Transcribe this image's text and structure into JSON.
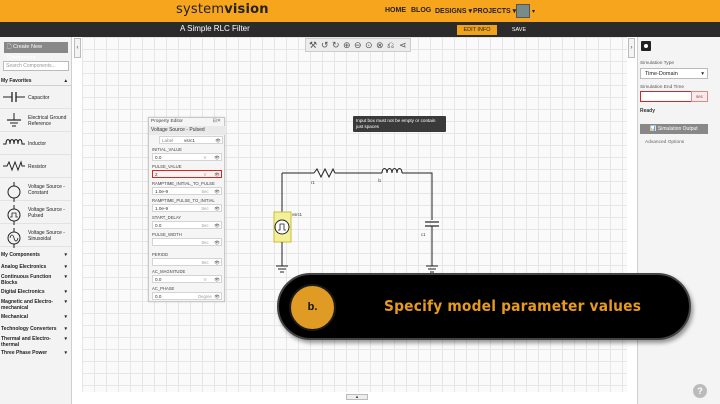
{
  "header": {
    "logo_regular": "system",
    "logo_bold": "vision",
    "nav": [
      "HOME",
      "BLOG",
      "DESIGNS ▾",
      "PROJECTS ▾"
    ]
  },
  "titlebar": {
    "title": "A Simple RLC Filter",
    "edit_info": "EDIT INFO",
    "save": "SAVE"
  },
  "left_panel": {
    "new_component": "🗋 Create New Component",
    "search_placeholder": "Search Components...",
    "favorites_header": "My Favorites",
    "favorites": [
      {
        "label": "Capacitor",
        "icon": "capacitor-icon"
      },
      {
        "label": "Electrical Ground Reference",
        "icon": "ground-icon"
      },
      {
        "label": "Inductor",
        "icon": "inductor-icon"
      },
      {
        "label": "Resistor",
        "icon": "resistor-icon"
      },
      {
        "label": "Voltage Source - Constant",
        "icon": "voltage-constant-icon"
      },
      {
        "label": "Voltage Source - Pulsed",
        "icon": "voltage-pulsed-icon"
      },
      {
        "label": "Voltage Source - Sinusoidal",
        "icon": "voltage-sine-icon"
      }
    ],
    "categories": [
      "My Components",
      "Analog Electronics",
      "Continuous Function Blocks",
      "Digital Electronics",
      "Magnetic and Electro-mechanical",
      "Mechanical",
      "Technology Converters",
      "Thermal and Electro-thermal",
      "Three Phase Power"
    ]
  },
  "property_editor": {
    "title": "Property Editor",
    "subtitle": "Voltage Source - Pulsed",
    "fields": [
      {
        "label": "Label",
        "value": "vsrc1",
        "unit": ""
      },
      {
        "label": "INITIAL_VALUE",
        "value": "0.0",
        "unit": "V"
      },
      {
        "label": "PULSE_VALUE",
        "value": "2",
        "unit": "V"
      },
      {
        "label": "RAMPTIME_INITIAL_TO_PULSE",
        "value": "1.0e-9",
        "unit": "Sec"
      },
      {
        "label": "RAMPTIME_PULSE_TO_INITIAL",
        "value": "1.0e-9",
        "unit": "Sec"
      },
      {
        "label": "START_DELAY",
        "value": "0.0",
        "unit": "Sec"
      },
      {
        "label": "PULSE_WIDTH",
        "value": "",
        "unit": "Sec"
      },
      {
        "label": "PERIOD",
        "value": "",
        "unit": "Sec"
      },
      {
        "label": "AC_MAGNITUDE",
        "value": "0.0",
        "unit": "V"
      },
      {
        "label": "AC_PHASE",
        "value": "0.0",
        "unit": "Degree"
      }
    ]
  },
  "tooltip": "Input box must not be empty or contain just spaces",
  "circuit": {
    "r1": "r1",
    "l1": "l1",
    "c1": "c1",
    "vsrc": "vsrc1"
  },
  "right_panel": {
    "sim_type_label": "Simulation Type",
    "sim_type_value": "Time-Domain",
    "end_time_label": "Simulation End Time",
    "end_time_unit": "sec",
    "status": "Ready",
    "sim_output": "📊 Simulation Output",
    "advanced": "Advanced Options"
  },
  "banner": {
    "step": "b.",
    "text": "Specify model parameter values"
  },
  "help": "?"
}
